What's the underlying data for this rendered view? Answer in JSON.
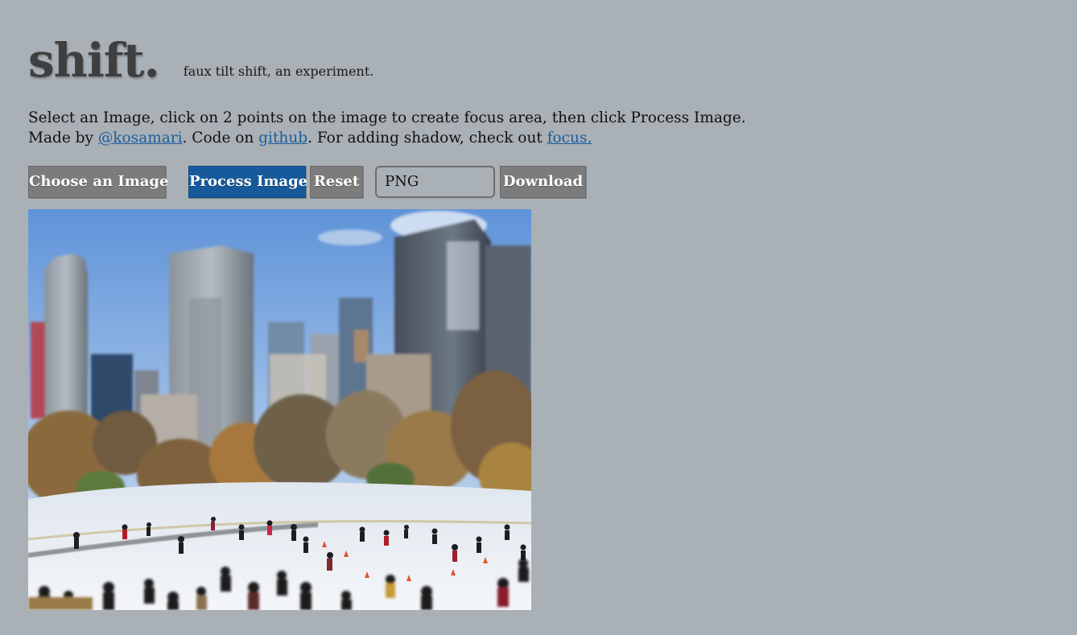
{
  "header": {
    "logo": "shift.",
    "tagline": "faux tilt shift, an experiment."
  },
  "instructions": {
    "line1": "Select an Image, click on 2 points on the image to create focus area, then click Process Image.",
    "made_by_prefix": "Made by ",
    "author_link": "@kosamari",
    "code_on_text": ". Code on ",
    "github_link": "github",
    "shadow_text": ". For adding shadow, check out ",
    "focus_link": "focus."
  },
  "controls": {
    "choose_label": "Choose an Image",
    "process_label": "Process Image",
    "reset_label": "Reset",
    "format_value": "PNG",
    "download_label": "Download"
  },
  "colors": {
    "background": "#a9b0b6",
    "button_gray": "#7c7c7c",
    "button_primary": "#175a9b",
    "link": "#1a5e9c"
  },
  "photo": {
    "subject": "winter skating rink in front of city skyline",
    "icon": "image-canvas"
  }
}
